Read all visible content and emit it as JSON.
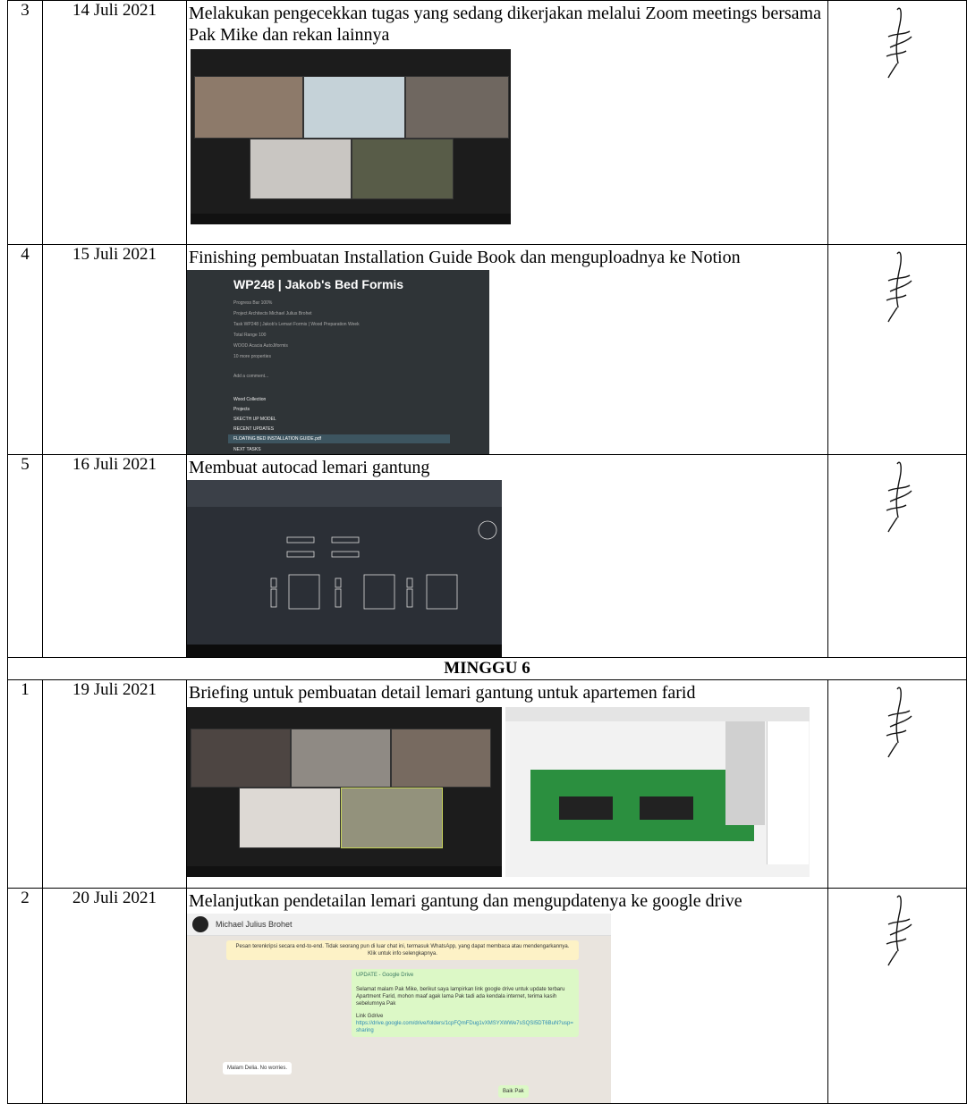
{
  "rows": [
    {
      "no": "3",
      "date": "14 Juli 2021",
      "activity": "Melakukan pengecekkan tugas yang sedang dikerjakan melalui Zoom meetings bersama Pak Mike dan rekan lainnya"
    },
    {
      "no": "4",
      "date": "15 Juli 2021",
      "activity": "Finishing pembuatan Installation Guide Book dan menguploadnya ke Notion"
    },
    {
      "no": "5",
      "date": "16 Juli 2021",
      "activity": "Membuat autocad lemari gantung"
    }
  ],
  "week_heading": "MINGGU 6",
  "rows_week6": [
    {
      "no": "1",
      "date": "19 Juli 2021",
      "activity": "Briefing untuk pembuatan detail lemari gantung untuk apartemen farid"
    },
    {
      "no": "2",
      "date": "20 Juli 2021",
      "activity": "Melanjutkan pendetailan lemari gantung dan mengupdatenya ke google drive"
    }
  ],
  "notion": {
    "title": "WP248 | Jakob's Bed Formis",
    "props": [
      "Progress Bar  100%",
      "Project Architects  Michael Julius Brohet",
      "Task  WP248 | Jakob's Lemari Formis | Wood Preparation Week",
      "Total Range  100",
      "WOOD  Acacia AutoJiformis",
      "10 more properties",
      "Add a comment..."
    ],
    "links": [
      "Wood Collection",
      "Projects",
      "SKECTH UP MODEL",
      "RECENT UPDATES",
      "FLOATING BED INSTALLATION GUIDE.pdf",
      "NEXT TASKS"
    ]
  },
  "whatsapp": {
    "contact": "Michael Julius Brohet",
    "notice": "Pesan terenkripsi secara end-to-end. Tidak seorang pun di luar chat ini, termasuk WhatsApp, yang dapat membaca atau mendengarkannya. Klik untuk info selengkapnya.",
    "msg_title": "UPDATE - Google Drive",
    "msg_body": "Selamat malam Pak Mike, berikut saya lampirkan link google drive untuk update terbaru Apartment Farid, mohon maaf agak lama Pak tadi ada kendala internet, terima kasih sebelumnya Pak",
    "msg_link_label": "Link Gdrive",
    "msg_link": "https://drive.google.com/drive/folders/1cpFQmFDug1vXMSYXWWe7sSQSI5DT6BuN?usp=sharing",
    "reply": "Malam Delia. No worries.",
    "last": "Baik Pak"
  }
}
